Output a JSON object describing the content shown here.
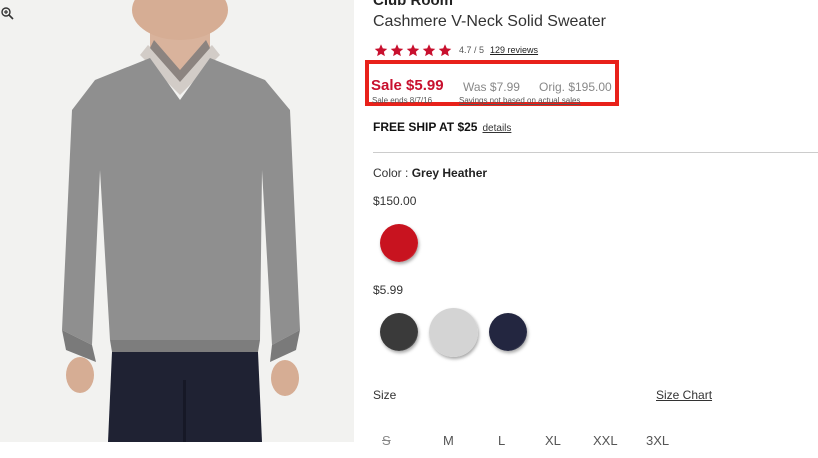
{
  "product": {
    "brand": "Club Room",
    "name": "Cashmere V-Neck Solid Sweater",
    "rating_value": 4.7,
    "rating_text": "4.7 / 5",
    "stars_filled": 5,
    "reviews_link": "129 reviews"
  },
  "pricing": {
    "sale": "Sale $5.99",
    "was": "Was $7.99",
    "orig": "Orig. $195.00",
    "sale_ends": "Sale ends 8/7/16",
    "savings_note": "Savings not based on actual sales",
    "highlight_color": "#e8211a",
    "sale_color": "#c8102e"
  },
  "shipping": {
    "text": "FREE SHIP AT $25",
    "details_link": "details"
  },
  "color": {
    "label": "Color :",
    "selected": "Grey Heather",
    "groups": [
      {
        "price": "$150.00",
        "swatches": [
          {
            "name": "red",
            "hex": "#c8131f"
          }
        ]
      },
      {
        "price": "$5.99",
        "swatches": [
          {
            "name": "charcoal",
            "hex": "#3a3a3a"
          },
          {
            "name": "grey-heather",
            "hex": "#d4d4d4"
          },
          {
            "name": "navy",
            "hex": "#232640"
          }
        ]
      }
    ]
  },
  "size": {
    "label": "Size",
    "chart_link": "Size Chart",
    "options": [
      {
        "label": "S",
        "available": false
      },
      {
        "label": "M",
        "available": true
      },
      {
        "label": "L",
        "available": true
      },
      {
        "label": "XL",
        "available": true
      },
      {
        "label": "XXL",
        "available": true
      },
      {
        "label": "3XL",
        "available": true
      }
    ]
  },
  "icons": {
    "zoom": "zoom-in-icon",
    "star": "star-icon"
  }
}
